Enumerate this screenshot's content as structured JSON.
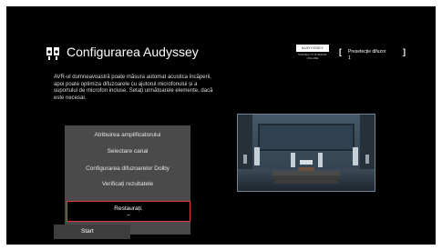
{
  "page": {
    "title": "Configurarea Audyssey",
    "description": "AVR-ul dumneavoastră poate măsura automat acustica încăperii, apoi poate optimiza difuzoarele cu ajutorul microfonului și a suportului de microfon incluse. Setați următoarele elemente, dacă este necesar.",
    "title_icon": "setup-speaker-icon"
  },
  "brand": {
    "name": "AUDYSSEY",
    "subtitle": "MULTEQ XT DYNAMIC VOLUME"
  },
  "preset": {
    "label": "Presetecție difuzor",
    "value": "1"
  },
  "menu": {
    "items": [
      {
        "label": "Atribuirea amplificatorului"
      },
      {
        "label": "Selectare canal"
      },
      {
        "label": "Configurarea difuzoarelor Dolby"
      },
      {
        "label": "Verificați rezultatele"
      }
    ],
    "highlighted": {
      "label": "Restaurați.",
      "sublabel": "–"
    }
  },
  "start_button": {
    "label": "Start"
  },
  "colors": {
    "background": "#000000",
    "panel": "#4a4a4a",
    "highlight_border": "#e53935",
    "text": "#ffffff"
  }
}
